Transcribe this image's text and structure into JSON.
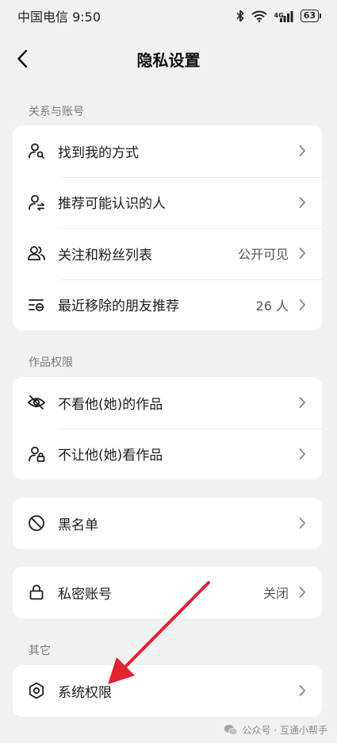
{
  "status_bar": {
    "carrier_time": "中国电信 9:50",
    "network": "4G",
    "battery": "63"
  },
  "header": {
    "title": "隐私设置"
  },
  "sections": {
    "relations": {
      "label": "关系与账号",
      "rows": [
        {
          "label": "找到我的方式",
          "value": "",
          "icon": "find-user-icon"
        },
        {
          "label": "推荐可能认识的人",
          "value": "",
          "icon": "recommend-user-icon"
        },
        {
          "label": "关注和粉丝列表",
          "value": "公开可见",
          "icon": "followers-icon"
        },
        {
          "label": "最近移除的朋友推荐",
          "value": "26 人",
          "icon": "removed-list-icon"
        }
      ]
    },
    "works": {
      "label": "作品权限",
      "rows": [
        {
          "label": "不看他(她)的作品",
          "value": "",
          "icon": "eye-off-icon"
        },
        {
          "label": "不让他(她)看作品",
          "value": "",
          "icon": "user-lock-icon"
        }
      ]
    },
    "blacklist": {
      "label": "黑名单",
      "icon": "block-icon"
    },
    "private": {
      "label": "私密账号",
      "value": "关闭",
      "icon": "lock-icon"
    },
    "other": {
      "label": "其它",
      "rows": [
        {
          "label": "系统权限",
          "value": "",
          "icon": "gear-icon"
        }
      ]
    }
  },
  "watermark": {
    "text": "公众号 · 互通小帮手"
  },
  "colors": {
    "background": "#f1f1f3",
    "card": "#ffffff",
    "annotation_arrow": "#e0232e"
  }
}
